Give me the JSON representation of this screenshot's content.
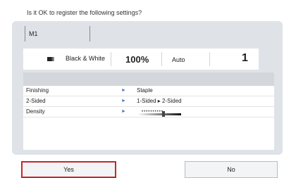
{
  "dialog": {
    "prompt": "Is it OK to register the following settings?"
  },
  "name_field": {
    "value": "M1"
  },
  "summary": {
    "color_mode": "Black & White",
    "copy_ratio": "100%",
    "paper": "Auto",
    "copies": "1"
  },
  "settings": [
    {
      "label": "Finishing",
      "value": "Staple"
    },
    {
      "label": "2-Sided",
      "value": "1-Sided ▸ 2-Sided"
    },
    {
      "label": "Density",
      "value": "",
      "level": 0.6
    }
  ],
  "buttons": {
    "yes": "Yes",
    "no": "No"
  },
  "colors": {
    "selected_border": "#c9252b",
    "arrow": "#4a7bbf",
    "panel_bg": "#dfe3e8"
  }
}
